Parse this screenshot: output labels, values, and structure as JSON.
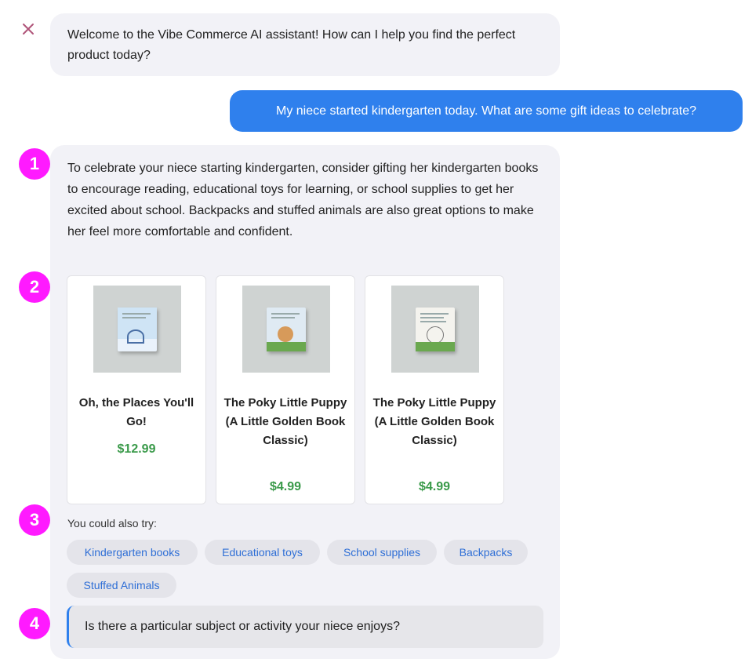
{
  "welcome_message": "Welcome to the Vibe Commerce AI assistant! How can I help you find the perfect product today?",
  "user_message": "My niece started kindergarten today. What are some gift ideas to celebrate?",
  "assistant": {
    "intro": "To celebrate your niece starting kindergarten, consider gifting her kindergarten books to encourage reading, educational toys for learning, or school supplies to get her excited about school. Backpacks and stuffed animals are also great options to make her feel more comfortable and confident.",
    "products": [
      {
        "title": "Oh, the Places You'll Go!",
        "price": "$12.99"
      },
      {
        "title": "The Poky Little Puppy (A Little Golden Book Classic)",
        "price": "$4.99"
      },
      {
        "title": "The Poky Little Puppy (A Little Golden Book Classic)",
        "price": "$4.99"
      }
    ],
    "also_try_label": "You could also try:",
    "suggestions": [
      "Kindergarten books",
      "Educational toys",
      "School supplies",
      "Backpacks",
      "Stuffed Animals"
    ],
    "follow_up_question": "Is there a particular subject or activity your niece enjoys?"
  },
  "markers": [
    "1",
    "2",
    "3",
    "4"
  ],
  "colors": {
    "accent": "#2f80ed",
    "price": "#3a9a4a",
    "marker": "#ff1aff",
    "logo": "#b0557a"
  }
}
